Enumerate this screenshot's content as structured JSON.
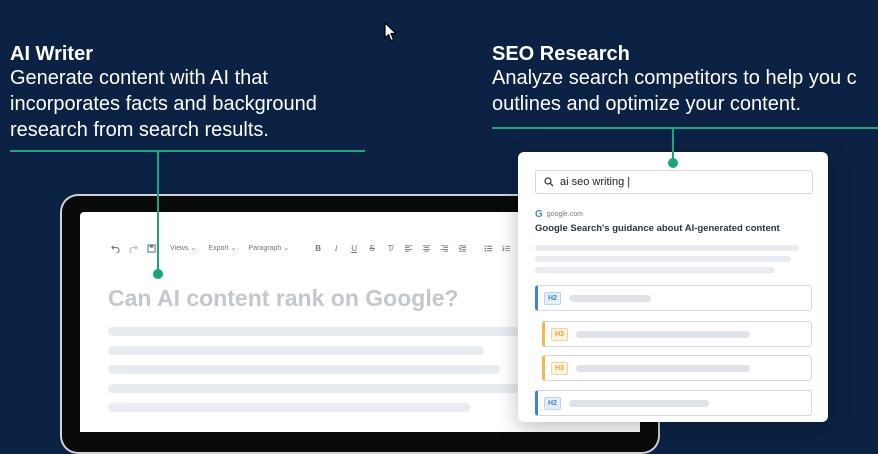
{
  "ai_writer": {
    "title": "AI Writer",
    "description": "Generate content with AI that incorporates facts and background research from search results."
  },
  "seo_research": {
    "title": "SEO Research",
    "description": "Analyze search competitors to help you c outlines and optimize your content."
  },
  "editor": {
    "toolbar": {
      "views_label": "Views",
      "export_label": "Export",
      "paragraph_label": "Paragraph"
    },
    "heading": "Can AI content rank on Google?"
  },
  "seo_card": {
    "search_value": "ai seo writing |",
    "result_domain": "google.com",
    "result_title": "Google Search's guidance about AI-generated content",
    "outline": [
      {
        "tag": "H2"
      },
      {
        "tag": "H3"
      },
      {
        "tag": "H3"
      },
      {
        "tag": "H2"
      }
    ]
  },
  "colors": {
    "background": "#0c2245",
    "accent_green": "#1aa67c",
    "h2_blue": "#3f82d8",
    "h3_orange": "#f2b84b"
  },
  "icons": [
    "undo-icon",
    "redo-icon",
    "save-icon",
    "bold-icon",
    "italic-icon",
    "underline-icon",
    "strikethrough-icon",
    "clear-format-icon",
    "align-left-icon",
    "align-center-icon",
    "align-right-icon",
    "indent-icon",
    "bullet-list-icon",
    "numbered-list-icon",
    "checklist-icon",
    "table-icon",
    "search-icon",
    "google-icon",
    "mouse-cursor-icon"
  ]
}
